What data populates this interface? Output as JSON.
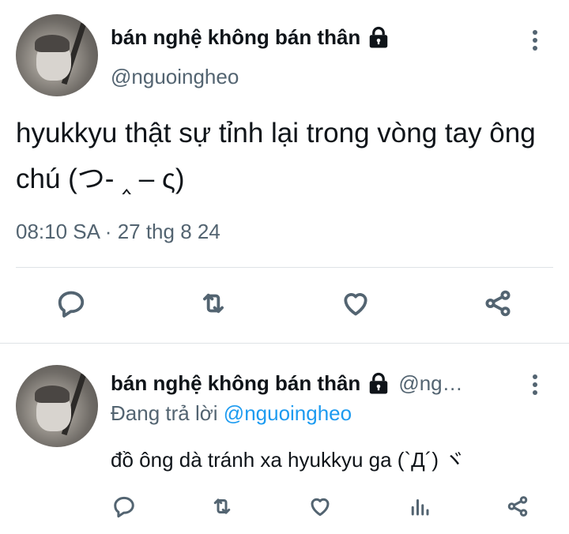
{
  "main_tweet": {
    "display_name": "bán nghệ không bán thân",
    "handle": "@nguoingheo",
    "text": "hyukkyu thật sự tỉnh lại trong vòng tay ông chú (つ- ‸ – ς)",
    "time": "08:10 SA",
    "separator": "·",
    "date": "27 thg 8 24",
    "actions": [
      "reply-icon",
      "retweet-icon",
      "like-icon",
      "share-icon"
    ]
  },
  "reply_tweet": {
    "display_name": "bán nghệ không bán thân",
    "handle": "@ng…",
    "replying_prefix": "Đang trả lời",
    "replying_to": "@nguoingheo",
    "text": "đồ ông dà tránh xa hyukkyu ga (`Д´) ヾ",
    "actions": [
      "reply-icon",
      "retweet-icon",
      "like-icon",
      "analytics-icon",
      "share-icon"
    ]
  },
  "colors": {
    "text": "#0f1419",
    "secondary": "#536471",
    "link": "#1d9bf0",
    "divider": "#dfe3e6"
  }
}
